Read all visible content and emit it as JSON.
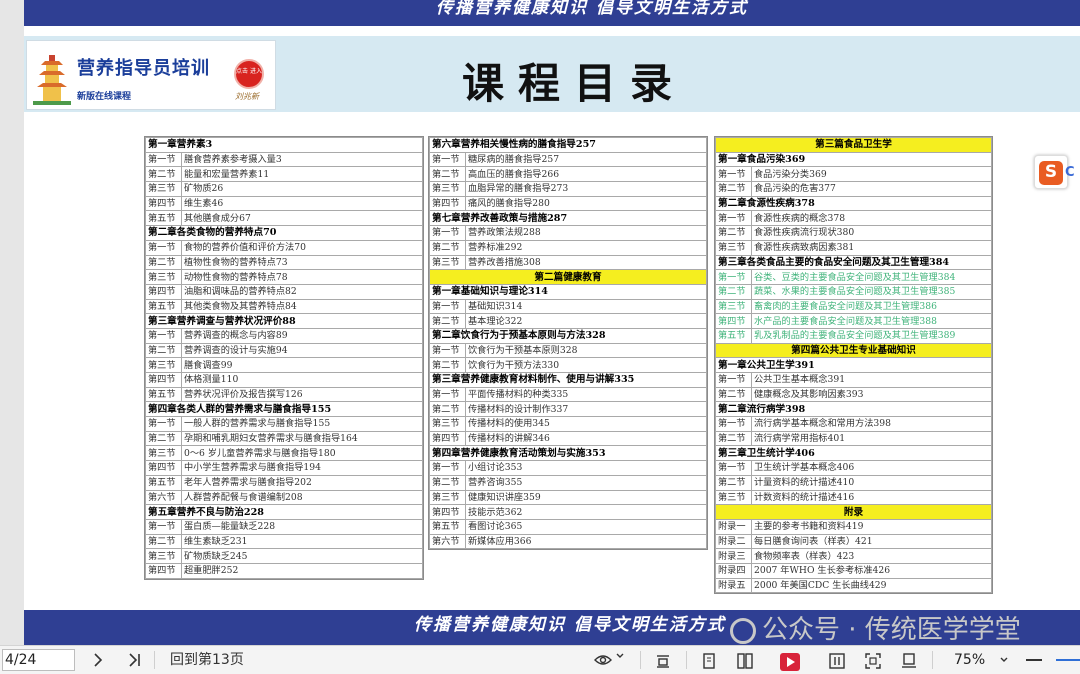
{
  "banner_top_text": "传播营养健康知识  倡导文明生活方式",
  "banner_bottom_text": "传播营养健康知识  倡导文明生活方式",
  "logo": {
    "title": "营养指导员培训",
    "subtitle": "新版在线课程",
    "seal_text": "点击 进入",
    "signature": "刘兆新"
  },
  "page_title": "课程目录",
  "watermark": "公众号 · 传统医学学堂",
  "side_badge": {
    "letter": "S",
    "letter2": "C"
  },
  "col1": [
    {
      "type": "chap",
      "text": "第一章营养素3"
    },
    {
      "sec": "第一节",
      "text": "膳食营养素参考摄入量3"
    },
    {
      "sec": "第二节",
      "text": "能量和宏量营养素11"
    },
    {
      "sec": "第三节",
      "text": "矿物质26"
    },
    {
      "sec": "第四节",
      "text": "维生素46"
    },
    {
      "sec": "第五节",
      "text": "其他膳食成分67"
    },
    {
      "type": "chap",
      "text": "第二章各类食物的营养特点70"
    },
    {
      "sec": "第一节",
      "text": "食物的营养价值和评价方法70"
    },
    {
      "sec": "第二节",
      "text": "植物性食物的营养特点73"
    },
    {
      "sec": "第三节",
      "text": "动物性食物的营养特点78"
    },
    {
      "sec": "第四节",
      "text": "油脂和调味品的营养特点82"
    },
    {
      "sec": "第五节",
      "text": "其他类食物及其营养特点84"
    },
    {
      "type": "chap",
      "text": "第三章营养调查与营养状况评价88"
    },
    {
      "sec": "第一节",
      "text": "营养调查的概念与内容89"
    },
    {
      "sec": "第二节",
      "text": "营养调查的设计与实施94"
    },
    {
      "sec": "第三节",
      "text": "膳食调查99"
    },
    {
      "sec": "第四节",
      "text": "体格测量110"
    },
    {
      "sec": "第五节",
      "text": "营养状况评价及报告撰写126"
    },
    {
      "type": "chap",
      "text": "第四章各类人群的营养需求与膳食指导155"
    },
    {
      "sec": "第一节",
      "text": "一般人群的营养需求与膳食指导155"
    },
    {
      "sec": "第二节",
      "text": "孕期和哺乳期妇女营养需求与膳食指导164"
    },
    {
      "sec": "第三节",
      "text": "0～6 岁儿童营养需求与膳食指导180"
    },
    {
      "sec": "第四节",
      "text": "中小学生营养需求与膳食指导194"
    },
    {
      "sec": "第五节",
      "text": "老年人营养需求与膳食指导202"
    },
    {
      "sec": "第六节",
      "text": "人群营养配餐与食谱编制208"
    },
    {
      "type": "chap",
      "text": "第五章营养不良与防治228"
    },
    {
      "sec": "第一节",
      "text": "蛋白质—能量缺乏228"
    },
    {
      "sec": "第二节",
      "text": "维生素缺乏231"
    },
    {
      "sec": "第三节",
      "text": "矿物质缺乏245"
    },
    {
      "sec": "第四节",
      "text": "超重肥胖252"
    }
  ],
  "col2": [
    {
      "type": "chap",
      "text": "第六章营养相关慢性病的膳食指导257"
    },
    {
      "sec": "第一节",
      "text": "糖尿病的膳食指导257"
    },
    {
      "sec": "第二节",
      "text": "高血压的膳食指导266"
    },
    {
      "sec": "第三节",
      "text": "血脂异常的膳食指导273"
    },
    {
      "sec": "第四节",
      "text": "痛风的膳食指导280"
    },
    {
      "type": "chap",
      "text": "第七章营养改善政策与措施287"
    },
    {
      "sec": "第一节",
      "text": "营养政策法规288"
    },
    {
      "sec": "第二节",
      "text": "营养标准292"
    },
    {
      "sec": "第三节",
      "text": "营养改善措施308"
    },
    {
      "type": "part",
      "text": "第二篇健康教育"
    },
    {
      "type": "chap",
      "text": "第一章基础知识与理论314"
    },
    {
      "sec": "第一节",
      "text": "基础知识314"
    },
    {
      "sec": "第二节",
      "text": "基本理论322"
    },
    {
      "type": "chap",
      "text": "第二章饮食行为于预基本原则与方法328"
    },
    {
      "sec": "第一节",
      "text": "饮食行为干预基本原则328"
    },
    {
      "sec": "第二节",
      "text": "饮食行为干预方法330"
    },
    {
      "type": "chap",
      "text": "第三章营养健康教育材料制作、使用与讲解335"
    },
    {
      "sec": "第一节",
      "text": "平面传播材料的种类335"
    },
    {
      "sec": "第二节",
      "text": "传播材料的设计制作337"
    },
    {
      "sec": "第三节",
      "text": "传播材料的使用345"
    },
    {
      "sec": "第四节",
      "text": "传播材料的讲解346"
    },
    {
      "type": "chap",
      "text": "第四章营养健康教育活动策划与实施353"
    },
    {
      "sec": "第一节",
      "text": "小组讨论353"
    },
    {
      "sec": "第二节",
      "text": "营养咨询355"
    },
    {
      "sec": "第三节",
      "text": "健康知识讲座359"
    },
    {
      "sec": "第四节",
      "text": "技能示范362"
    },
    {
      "sec": "第五节",
      "text": "看图讨论365"
    },
    {
      "sec": "第六节",
      "text": "新媒体应用366"
    }
  ],
  "col3": [
    {
      "type": "part",
      "text": "第三篇食品卫生学"
    },
    {
      "type": "chap",
      "text": "第一章食品污染369"
    },
    {
      "sec": "第一节",
      "text": "食品污染分类369"
    },
    {
      "sec": "第二节",
      "text": "食品污染的危害377"
    },
    {
      "type": "chap",
      "text": "第二章食源性疾病378"
    },
    {
      "sec": "第一节",
      "text": "食源性疾病的概念378"
    },
    {
      "sec": "第二节",
      "text": "食源性疾病流行现状380"
    },
    {
      "sec": "第三节",
      "text": "食源性疾病致病因素381"
    },
    {
      "type": "chap",
      "text": "第三章各类食品主要的食品安全问题及其卫生管理384"
    },
    {
      "sec": "第一节",
      "text": "谷类、豆类的主要食品安全问题及其卫生管理384",
      "green": true
    },
    {
      "sec": "第二节",
      "text": "蔬菜、水果的主要食品安全问题及其卫生管理385",
      "green": true
    },
    {
      "sec": "第三节",
      "text": "畜禽肉的主要食品安全问题及其卫生管理386",
      "green": true
    },
    {
      "sec": "第四节",
      "text": "水产品的主要食品安全问题及其卫生管理388",
      "green": true
    },
    {
      "sec": "第五节",
      "text": "乳及乳制品的主要食品安全问题及其卫生管理389",
      "green": true
    },
    {
      "type": "part",
      "text": "第四篇公共卫生专业基础知识"
    },
    {
      "type": "chap",
      "text": "第一章公共卫生学391"
    },
    {
      "sec": "第一节",
      "text": "公共卫生基本概念391"
    },
    {
      "sec": "第二节",
      "text": "健康概念及其影响因素393"
    },
    {
      "type": "chap",
      "text": "第二章流行病学398"
    },
    {
      "sec": "第一节",
      "text": "流行病学基本概念和常用方法398"
    },
    {
      "sec": "第二节",
      "text": "流行病学常用指标401"
    },
    {
      "type": "chap",
      "text": "第三章卫生统计学406"
    },
    {
      "sec": "第一节",
      "text": "卫生统计学基本概念406"
    },
    {
      "sec": "第二节",
      "text": "计量资料的统计描述410"
    },
    {
      "sec": "第三节",
      "text": "计数资料的统计描述416"
    },
    {
      "type": "part",
      "text": "附录"
    },
    {
      "sec": "附录一",
      "text": "主要的参考书籍和资料419"
    },
    {
      "sec": "附录二",
      "text": "每日膳食询问表（样表）421"
    },
    {
      "sec": "附录三",
      "text": "食物频率表（样表）423"
    },
    {
      "sec": "附录四",
      "text": "2007 年WHO 生长参考标准426"
    },
    {
      "sec": "附录五",
      "text": "2000 年美国CDC 生长曲线429"
    }
  ],
  "toolbar": {
    "page_input": "4/24",
    "goto_label": "回到第13页",
    "zoom_value": "75%"
  },
  "icons": [
    "next-page-icon",
    "last-page-icon",
    "eye-icon",
    "dropdown-icon",
    "fit-width-icon",
    "single-page-icon",
    "two-page-icon",
    "play-icon",
    "columns-icon",
    "fit-page-icon",
    "bookmark-stand-icon",
    "zoom-out-icon"
  ],
  "colors": {
    "banner": "#2f3f93",
    "part_highlight": "#f5ee1f",
    "green_text": "#3fb37a",
    "title_blue": "#1b3e9a",
    "play_red": "#d8233a"
  }
}
